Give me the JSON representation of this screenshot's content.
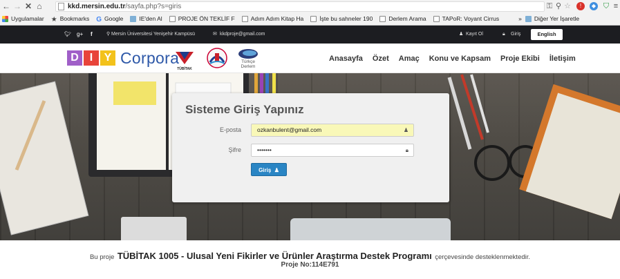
{
  "browser": {
    "url_host": "kkd.mersin.edu.tr",
    "url_path": "/sayfa.php?s=giris",
    "bookmarks": [
      {
        "label": "Uygulamalar",
        "icon": "apps-grid-icon"
      },
      {
        "label": "Bookmarks",
        "icon": "star-icon"
      },
      {
        "label": "Google",
        "icon": "google-icon"
      },
      {
        "label": "IE'den Al",
        "icon": "folder-icon"
      },
      {
        "label": "PROJE ÖN TEKLİF F",
        "icon": "page-icon"
      },
      {
        "label": "Adım Adım Kitap Ha",
        "icon": "page-icon"
      },
      {
        "label": "İşte bu sahneler 190",
        "icon": "page-icon"
      },
      {
        "label": "Derlem Arama",
        "icon": "page-icon"
      },
      {
        "label": "TAPoR: Voyant Cirrus",
        "icon": "page-icon"
      }
    ],
    "overflow": "»",
    "other_bookmarks": "Diğer Yer İşaretle"
  },
  "topbar": {
    "address": "Mersin Üniversitesi Yenişehir Kampüsü",
    "email": "kkdproje@gmail.com",
    "register": "Kayıt Ol",
    "login": "Giriş",
    "language": "English"
  },
  "header": {
    "logo_letters": [
      "D",
      "I",
      "Y"
    ],
    "logo_word": "Corpora",
    "tubitak_label": "TÜBİTAK",
    "turkce_derlem_line1": "Türkçe",
    "turkce_derlem_line2": "Derlem",
    "menu": [
      "Anasayfa",
      "Özet",
      "Amaç",
      "Konu ve Kapsam",
      "Proje Ekibi",
      "İletişim"
    ]
  },
  "login": {
    "title": "Sisteme Giriş Yapınız",
    "email_label": "E-posta",
    "email_value": "ozkanbulent@gmail.com",
    "password_label": "Şifre",
    "password_value": "•••••••",
    "button": "Giriş"
  },
  "footer": {
    "prefix": "Bu proje",
    "program": "TÜBİTAK 1005 - Ulusal Yeni Fikirler ve Ürünler Araştırma Destek Programı",
    "suffix": "çerçevesinde desteklenmektedir.",
    "project_no": "Proje No:114E791"
  },
  "colors": {
    "logo_d": "#a05fc8",
    "logo_i": "#e8443a",
    "logo_y": "#f3c21b",
    "login_button": "#2a85c4",
    "autofill": "#f9f8b8"
  }
}
